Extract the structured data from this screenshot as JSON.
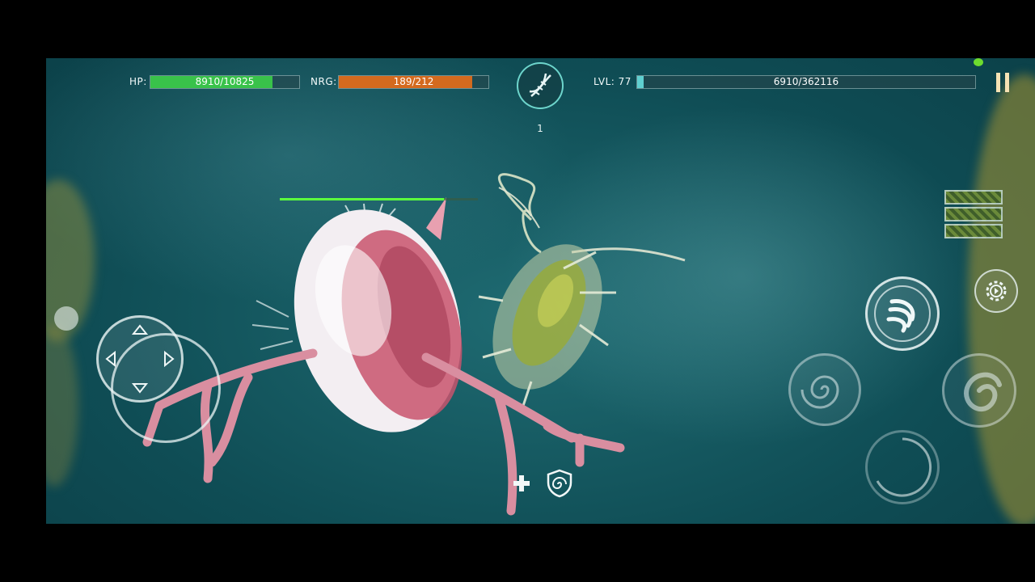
{
  "hud": {
    "hp": {
      "label": "HP:",
      "value_text": "8910/10825",
      "current": 8910,
      "max": 10825,
      "color": "#39c24a"
    },
    "nrg": {
      "label": "NRG:",
      "value_text": "189/212",
      "current": 189,
      "max": 212,
      "color": "#d46a1e"
    },
    "dna": {
      "icon": "dna-icon",
      "count": "1"
    },
    "level": {
      "label": "LVL: 77",
      "xp_text": "6910/362116",
      "current": 6910,
      "max": 362116,
      "color": "#5fd0d0"
    }
  },
  "controls": {
    "pause_icon": "pause-icon",
    "joystick_icon": "dpad-joystick",
    "skills": [
      "claw-swirl-icon",
      "vortex-icon",
      "spiral-shell-icon",
      "cooldown-ring-icon"
    ],
    "settings_icon": "gear-play-icon",
    "inventory_slots": 3,
    "buffs": [
      "heal-plus-icon",
      "shield-swirl-icon"
    ]
  },
  "target": {
    "health_fraction": 0.83,
    "color": "#5cff3e"
  }
}
